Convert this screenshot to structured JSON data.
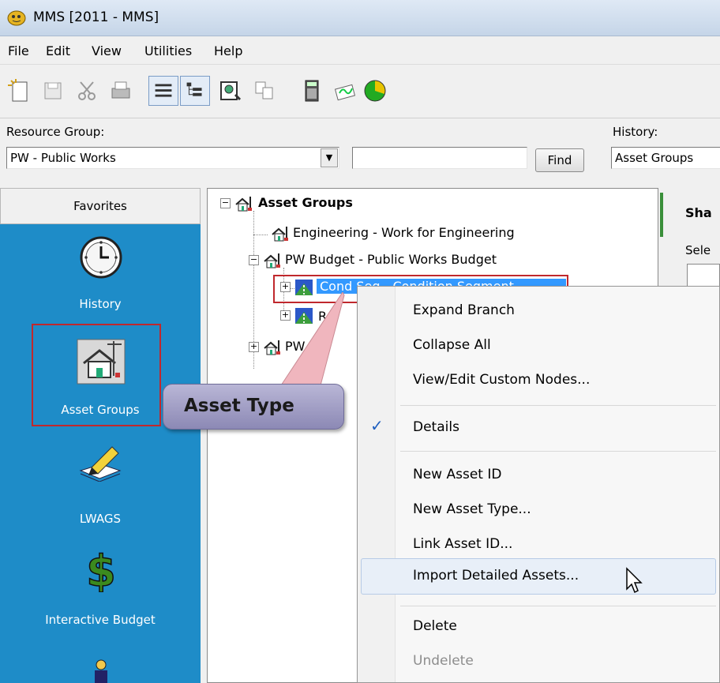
{
  "window": {
    "title": "MMS [2011 - MMS]"
  },
  "menu": [
    "File",
    "Edit",
    "View",
    "Utilities",
    "Help"
  ],
  "filters": {
    "resource_group_label": "Resource Group:",
    "resource_group_value": "PW - Public Works",
    "search_value": "",
    "find_label": "Find",
    "history_label": "History:",
    "history_value": "Asset Groups"
  },
  "favorites": {
    "header": "Favorites",
    "items": [
      {
        "label": "History",
        "icon": "clock-icon"
      },
      {
        "label": "Asset Groups",
        "icon": "house-icon"
      },
      {
        "label": "LWAGS",
        "icon": "pencil-paper-icon"
      },
      {
        "label": "Interactive Budget",
        "icon": "dollar-icon"
      }
    ]
  },
  "tree": {
    "root": "Asset Groups",
    "n1": "Engineering - Work for Engineering",
    "n2": "PW Budget - Public Works Budget",
    "n3": "Cond Seg - Condition Segment",
    "n4": "Rd",
    "n5": "PW Cu"
  },
  "right": {
    "title": "Sha",
    "select_label": "Sele"
  },
  "context_menu": {
    "items": [
      {
        "label": "Expand Branch",
        "enabled": true
      },
      {
        "label": "Collapse All",
        "enabled": true
      },
      {
        "label": "View/Edit Custom Nodes...",
        "enabled": true
      },
      {
        "label": "Details",
        "enabled": true,
        "checked": true
      },
      {
        "label": "New Asset ID",
        "enabled": true
      },
      {
        "label": "New Asset Type...",
        "enabled": true
      },
      {
        "label": "Link Asset ID...",
        "enabled": true
      },
      {
        "label": "Import Detailed Assets...",
        "enabled": true,
        "highlighted": true
      },
      {
        "label": "Delete",
        "enabled": true
      },
      {
        "label": "Undelete",
        "enabled": false
      }
    ],
    "check_glyph": "✓"
  },
  "callout": {
    "text": "Asset Type"
  },
  "colors": {
    "favorites_bg": "#1e8cc8",
    "annotation_red": "#c0282d",
    "selection_blue": "#3399ff",
    "callout_fill": "#a9a6cc"
  }
}
